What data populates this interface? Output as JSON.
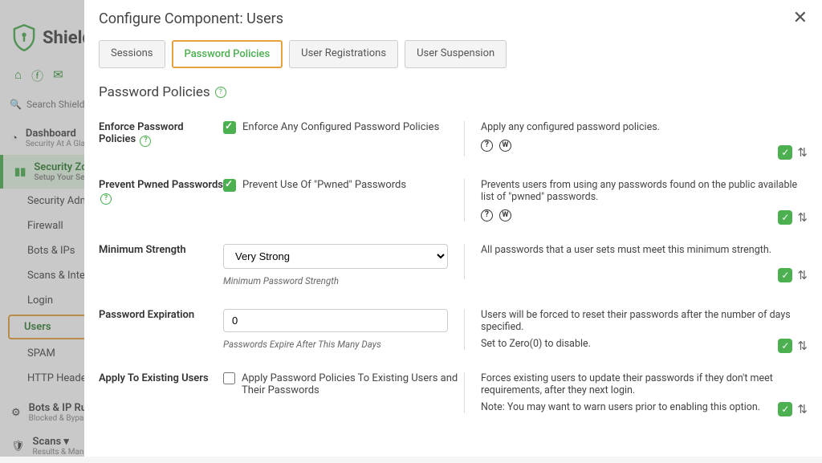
{
  "brand": "Shield",
  "search_placeholder": "Search ShieldPRO",
  "sidebar": {
    "dashboard": {
      "label": "Dashboard",
      "sub": "Security At A Glance"
    },
    "security_zones": {
      "label": "Security Zones",
      "sub": "Setup Your Security"
    },
    "items": [
      {
        "label": "Security Admin"
      },
      {
        "label": "Firewall"
      },
      {
        "label": "Bots & IPs"
      },
      {
        "label": "Scans & Integrity"
      },
      {
        "label": "Login"
      },
      {
        "label": "Users"
      },
      {
        "label": "SPAM"
      },
      {
        "label": "HTTP Headers"
      }
    ],
    "bots_rules": {
      "label": "Bots & IP Rules",
      "sub": "Blocked & Bypass"
    },
    "scans": {
      "label": "Scans ▾",
      "sub": "Results & Manual"
    }
  },
  "modal": {
    "title": "Configure Component: Users",
    "tabs": [
      "Sessions",
      "Password Policies",
      "User Registrations",
      "User Suspension"
    ],
    "section_title": "Password Policies",
    "rows": {
      "enforce": {
        "label": "Enforce Password Policies",
        "checkbox_label": "Enforce Any Configured Password Policies",
        "desc": "Apply any configured password policies."
      },
      "pwned": {
        "label": "Prevent Pwned Passwords",
        "checkbox_label": "Prevent Use Of \"Pwned\" Passwords",
        "desc": "Prevents users from using any passwords found on the public available list of \"pwned\" passwords."
      },
      "strength": {
        "label": "Minimum Strength",
        "value": "Very Strong",
        "hint": "Minimum Password Strength",
        "desc": "All passwords that a user sets must meet this minimum strength."
      },
      "expiration": {
        "label": "Password Expiration",
        "value": "0",
        "hint": "Passwords Expire After This Many Days",
        "desc1": "Users will be forced to reset their passwords after the number of days specified.",
        "desc2": "Set to Zero(0) to disable."
      },
      "existing": {
        "label": "Apply To Existing Users",
        "checkbox_label": "Apply Password Policies To Existing Users and Their Passwords",
        "desc1": "Forces existing users to update their passwords if they don't meet requirements, after they next login.",
        "desc2": "Note: You may want to warn users prior to enabling this option."
      }
    }
  }
}
